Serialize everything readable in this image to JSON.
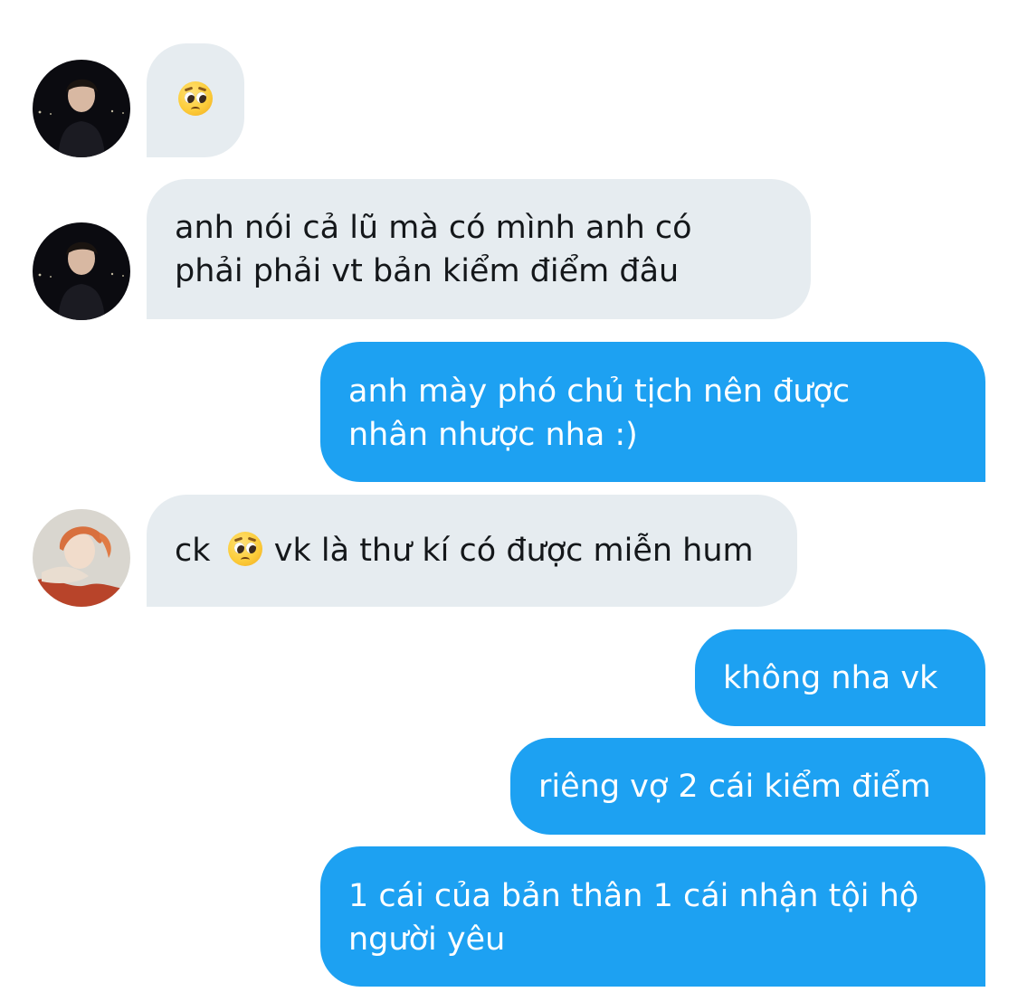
{
  "conversation": {
    "messages": [
      {
        "sender": "contact",
        "lines": [
          "🥺"
        ]
      },
      {
        "sender": "contact",
        "lines": [
          "anh nói cả lũ mà có mình anh có",
          "phải phải vt bản kiểm điểm đâu"
        ]
      },
      {
        "sender": "me",
        "lines": [
          "anh mày phó chủ tịch nên được",
          "nhân nhược nha :)"
        ]
      },
      {
        "sender": "contact",
        "text_before": "ck",
        "emoji": "🥺",
        "text_after": "vk là thư kí có được miễn hum"
      },
      {
        "sender": "me",
        "lines": [
          "không nha vk"
        ]
      },
      {
        "sender": "me",
        "lines": [
          "riêng vợ 2 cái kiểm điểm"
        ]
      },
      {
        "sender": "me",
        "lines": [
          "1 cái của bản thân 1 cái nhận tội hộ",
          "người yêu"
        ]
      }
    ]
  },
  "colors": {
    "incoming_bubble": "#e6ecf0",
    "outgoing_bubble": "#1da1f2",
    "incoming_text": "#14171a",
    "outgoing_text": "#ffffff",
    "background": "#ffffff"
  },
  "icons": {
    "pleading_face": "pleading-face-emoji-icon"
  }
}
